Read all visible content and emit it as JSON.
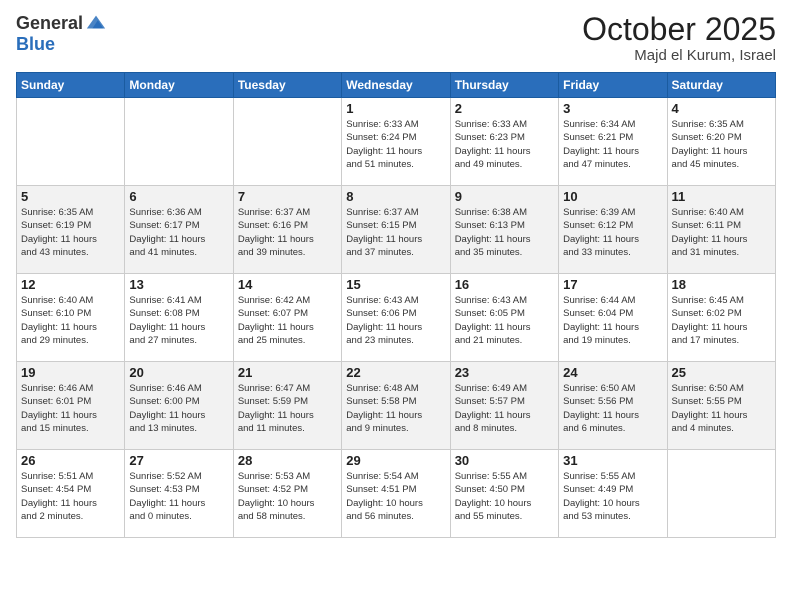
{
  "header": {
    "logo_line1": "General",
    "logo_line2": "Blue",
    "month": "October 2025",
    "location": "Majd el Kurum, Israel"
  },
  "weekdays": [
    "Sunday",
    "Monday",
    "Tuesday",
    "Wednesday",
    "Thursday",
    "Friday",
    "Saturday"
  ],
  "weeks": [
    [
      {
        "day": "",
        "info": ""
      },
      {
        "day": "",
        "info": ""
      },
      {
        "day": "",
        "info": ""
      },
      {
        "day": "1",
        "info": "Sunrise: 6:33 AM\nSunset: 6:24 PM\nDaylight: 11 hours\nand 51 minutes."
      },
      {
        "day": "2",
        "info": "Sunrise: 6:33 AM\nSunset: 6:23 PM\nDaylight: 11 hours\nand 49 minutes."
      },
      {
        "day": "3",
        "info": "Sunrise: 6:34 AM\nSunset: 6:21 PM\nDaylight: 11 hours\nand 47 minutes."
      },
      {
        "day": "4",
        "info": "Sunrise: 6:35 AM\nSunset: 6:20 PM\nDaylight: 11 hours\nand 45 minutes."
      }
    ],
    [
      {
        "day": "5",
        "info": "Sunrise: 6:35 AM\nSunset: 6:19 PM\nDaylight: 11 hours\nand 43 minutes."
      },
      {
        "day": "6",
        "info": "Sunrise: 6:36 AM\nSunset: 6:17 PM\nDaylight: 11 hours\nand 41 minutes."
      },
      {
        "day": "7",
        "info": "Sunrise: 6:37 AM\nSunset: 6:16 PM\nDaylight: 11 hours\nand 39 minutes."
      },
      {
        "day": "8",
        "info": "Sunrise: 6:37 AM\nSunset: 6:15 PM\nDaylight: 11 hours\nand 37 minutes."
      },
      {
        "day": "9",
        "info": "Sunrise: 6:38 AM\nSunset: 6:13 PM\nDaylight: 11 hours\nand 35 minutes."
      },
      {
        "day": "10",
        "info": "Sunrise: 6:39 AM\nSunset: 6:12 PM\nDaylight: 11 hours\nand 33 minutes."
      },
      {
        "day": "11",
        "info": "Sunrise: 6:40 AM\nSunset: 6:11 PM\nDaylight: 11 hours\nand 31 minutes."
      }
    ],
    [
      {
        "day": "12",
        "info": "Sunrise: 6:40 AM\nSunset: 6:10 PM\nDaylight: 11 hours\nand 29 minutes."
      },
      {
        "day": "13",
        "info": "Sunrise: 6:41 AM\nSunset: 6:08 PM\nDaylight: 11 hours\nand 27 minutes."
      },
      {
        "day": "14",
        "info": "Sunrise: 6:42 AM\nSunset: 6:07 PM\nDaylight: 11 hours\nand 25 minutes."
      },
      {
        "day": "15",
        "info": "Sunrise: 6:43 AM\nSunset: 6:06 PM\nDaylight: 11 hours\nand 23 minutes."
      },
      {
        "day": "16",
        "info": "Sunrise: 6:43 AM\nSunset: 6:05 PM\nDaylight: 11 hours\nand 21 minutes."
      },
      {
        "day": "17",
        "info": "Sunrise: 6:44 AM\nSunset: 6:04 PM\nDaylight: 11 hours\nand 19 minutes."
      },
      {
        "day": "18",
        "info": "Sunrise: 6:45 AM\nSunset: 6:02 PM\nDaylight: 11 hours\nand 17 minutes."
      }
    ],
    [
      {
        "day": "19",
        "info": "Sunrise: 6:46 AM\nSunset: 6:01 PM\nDaylight: 11 hours\nand 15 minutes."
      },
      {
        "day": "20",
        "info": "Sunrise: 6:46 AM\nSunset: 6:00 PM\nDaylight: 11 hours\nand 13 minutes."
      },
      {
        "day": "21",
        "info": "Sunrise: 6:47 AM\nSunset: 5:59 PM\nDaylight: 11 hours\nand 11 minutes."
      },
      {
        "day": "22",
        "info": "Sunrise: 6:48 AM\nSunset: 5:58 PM\nDaylight: 11 hours\nand 9 minutes."
      },
      {
        "day": "23",
        "info": "Sunrise: 6:49 AM\nSunset: 5:57 PM\nDaylight: 11 hours\nand 8 minutes."
      },
      {
        "day": "24",
        "info": "Sunrise: 6:50 AM\nSunset: 5:56 PM\nDaylight: 11 hours\nand 6 minutes."
      },
      {
        "day": "25",
        "info": "Sunrise: 6:50 AM\nSunset: 5:55 PM\nDaylight: 11 hours\nand 4 minutes."
      }
    ],
    [
      {
        "day": "26",
        "info": "Sunrise: 5:51 AM\nSunset: 4:54 PM\nDaylight: 11 hours\nand 2 minutes."
      },
      {
        "day": "27",
        "info": "Sunrise: 5:52 AM\nSunset: 4:53 PM\nDaylight: 11 hours\nand 0 minutes."
      },
      {
        "day": "28",
        "info": "Sunrise: 5:53 AM\nSunset: 4:52 PM\nDaylight: 10 hours\nand 58 minutes."
      },
      {
        "day": "29",
        "info": "Sunrise: 5:54 AM\nSunset: 4:51 PM\nDaylight: 10 hours\nand 56 minutes."
      },
      {
        "day": "30",
        "info": "Sunrise: 5:55 AM\nSunset: 4:50 PM\nDaylight: 10 hours\nand 55 minutes."
      },
      {
        "day": "31",
        "info": "Sunrise: 5:55 AM\nSunset: 4:49 PM\nDaylight: 10 hours\nand 53 minutes."
      },
      {
        "day": "",
        "info": ""
      }
    ]
  ]
}
